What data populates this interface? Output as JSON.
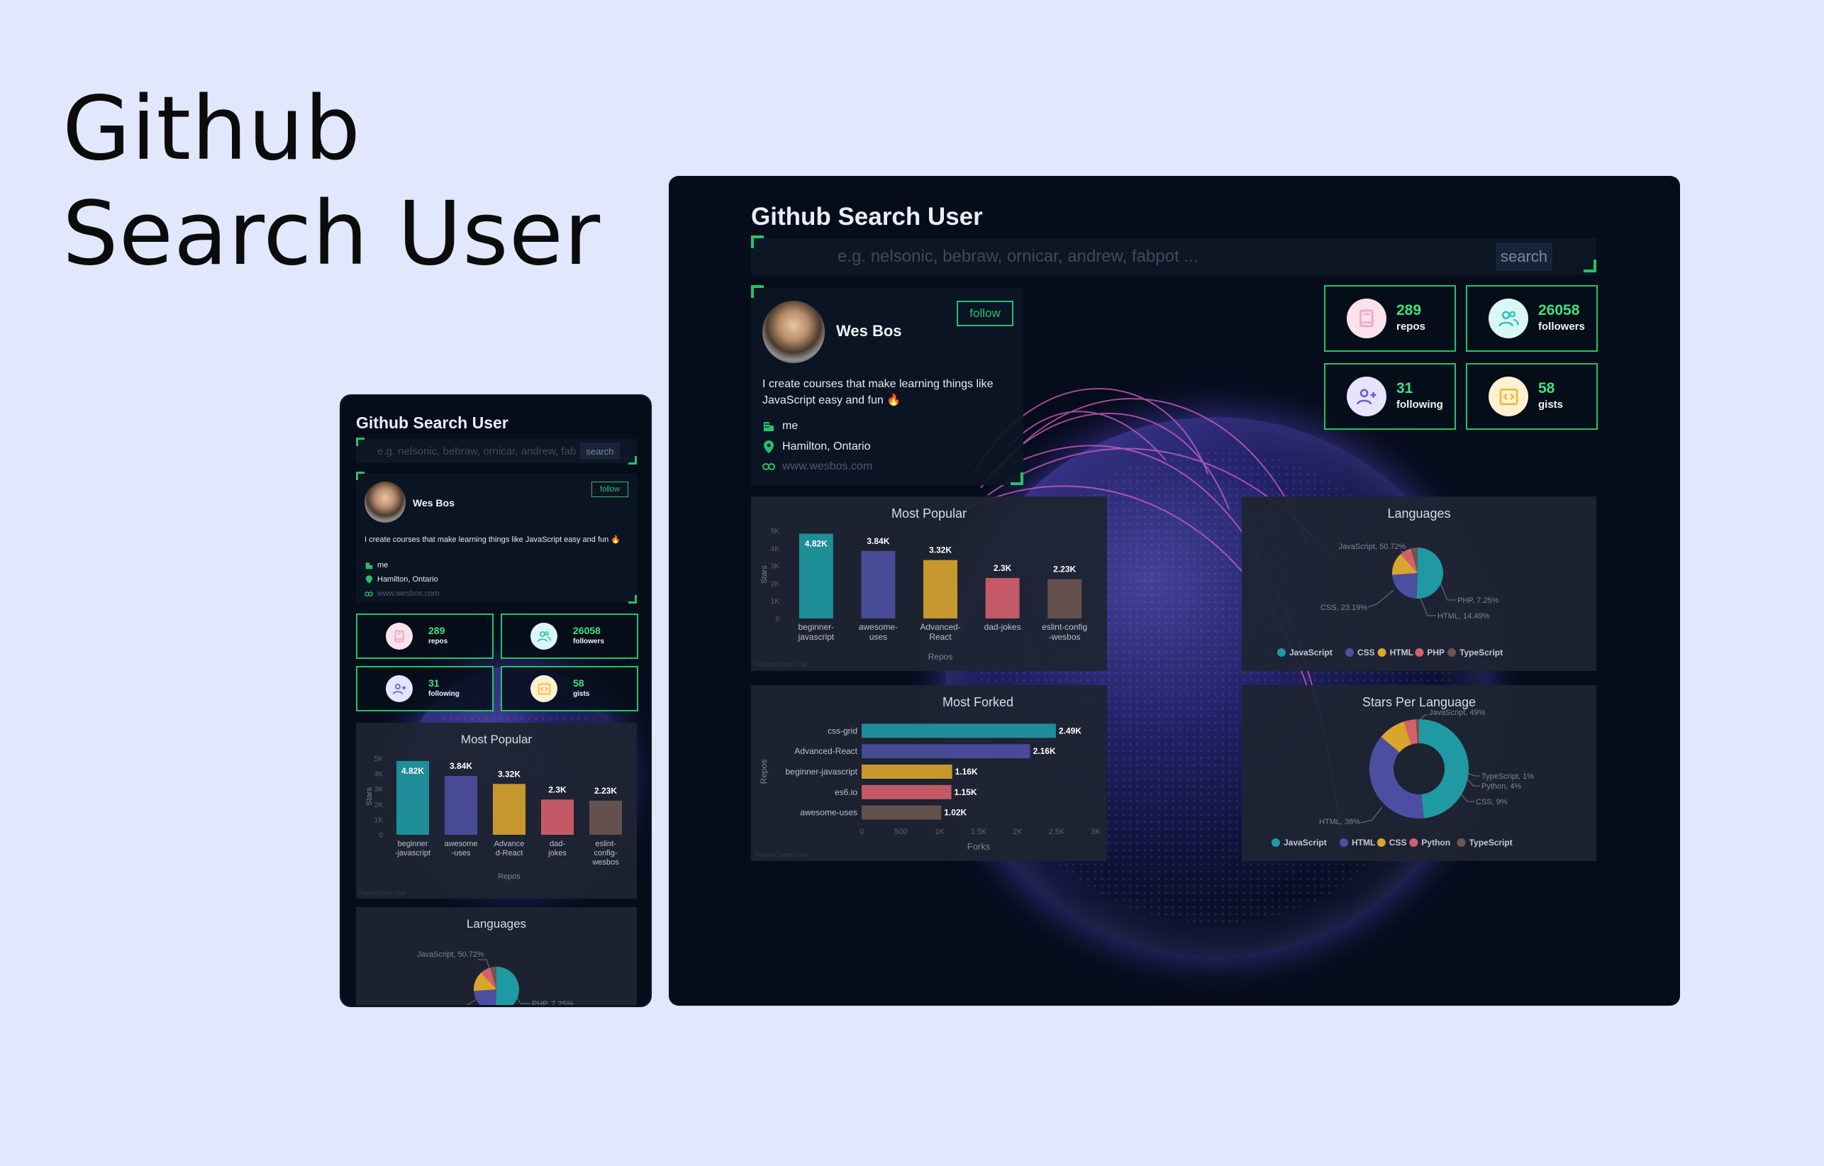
{
  "hero": {
    "line1": "Github",
    "line2": "Search User"
  },
  "app": {
    "title": "Github Search User",
    "search": {
      "placeholder": "e.g. nelsonic, bebraw, ornicar, andrew, fabpot ...",
      "button": "search"
    },
    "user": {
      "name": "Wes Bos",
      "follow_label": "follow",
      "bio": "I create courses that make learning things like JavaScript easy and fun 🔥",
      "company": "me",
      "location": "Hamilton, Ontario",
      "blog": "www.wesbos.com"
    },
    "stats": [
      {
        "value": "289",
        "label": "repos",
        "icon": "repo-book-icon",
        "color": "#f3a7c4",
        "bg": "#fde2ec"
      },
      {
        "value": "26058",
        "label": "followers",
        "icon": "followers-icon",
        "color": "#2bc3c0",
        "bg": "#daf7f6"
      },
      {
        "value": "31",
        "label": "following",
        "icon": "add-user-icon",
        "color": "#6b5dd3",
        "bg": "#e6e3fb"
      },
      {
        "value": "58",
        "label": "gists",
        "icon": "code-icon",
        "color": "#f2b733",
        "bg": "#fdf1d2"
      }
    ],
    "credit": "FusionCharts Trial"
  },
  "chart_data": [
    {
      "type": "bar",
      "title": "Most Popular",
      "xlabel": "Repos",
      "ylabel": "Stars",
      "categories": [
        "beginner-javascript",
        "awesome-uses",
        "Advanced-React",
        "dad-jokes",
        "eslint-config-wesbos"
      ],
      "values": [
        4820,
        3840,
        3320,
        2300,
        2230
      ],
      "value_labels": [
        "4.82K",
        "3.84K",
        "3.32K",
        "2.3K",
        "2.23K"
      ],
      "y_ticks": [
        "0",
        "1K",
        "2K",
        "3K",
        "4K",
        "5K"
      ],
      "ylim": [
        0,
        5000
      ],
      "colors": [
        "#1f9aa3",
        "#4c4fa1",
        "#d9a52d",
        "#d65f6d",
        "#6b5650"
      ]
    },
    {
      "type": "pie",
      "title": "Languages",
      "labels": [
        "JavaScript",
        "CSS",
        "HTML",
        "PHP",
        "TypeScript"
      ],
      "values": [
        50.72,
        23.19,
        14.49,
        7.25,
        4.35
      ],
      "annotations": [
        "JavaScript, 50.72%",
        "CSS, 23.19%",
        "HTML, 14.49%",
        "PHP, 7.25%"
      ],
      "colors": [
        "#1f9aa3",
        "#4c4fa1",
        "#d9a52d",
        "#d65f6d",
        "#6b5650"
      ],
      "legend": "bottom"
    },
    {
      "type": "bar",
      "orientation": "horizontal",
      "title": "Most Forked",
      "xlabel": "Forks",
      "ylabel": "Repos",
      "categories": [
        "css-grid",
        "Advanced-React",
        "beginner-javascript",
        "es6.io",
        "awesome-uses"
      ],
      "values": [
        2490,
        2160,
        1160,
        1150,
        1020
      ],
      "value_labels": [
        "2.49K",
        "2.16K",
        "1.16K",
        "1.15K",
        "1.02K"
      ],
      "x_ticks": [
        "0",
        "500",
        "1K",
        "1.5K",
        "2K",
        "2.5K",
        "3K"
      ],
      "xlim": [
        0,
        3000
      ],
      "colors": [
        "#1f9aa3",
        "#4c4fa1",
        "#d9a52d",
        "#d65f6d",
        "#6b5650"
      ]
    },
    {
      "type": "pie",
      "subtype": "doughnut",
      "title": "Stars Per Language",
      "labels": [
        "JavaScript",
        "HTML",
        "CSS",
        "Python",
        "TypeScript"
      ],
      "values": [
        49,
        38,
        9,
        4,
        1
      ],
      "annotations": [
        "JavaScript, 49%",
        "HTML, 38%",
        "CSS, 9%",
        "Python, 4%",
        "TypeScript, 1%"
      ],
      "colors": [
        "#1f9aa3",
        "#4c4fa1",
        "#d9a52d",
        "#d65f6d",
        "#6b5650"
      ],
      "legend": "bottom"
    }
  ]
}
